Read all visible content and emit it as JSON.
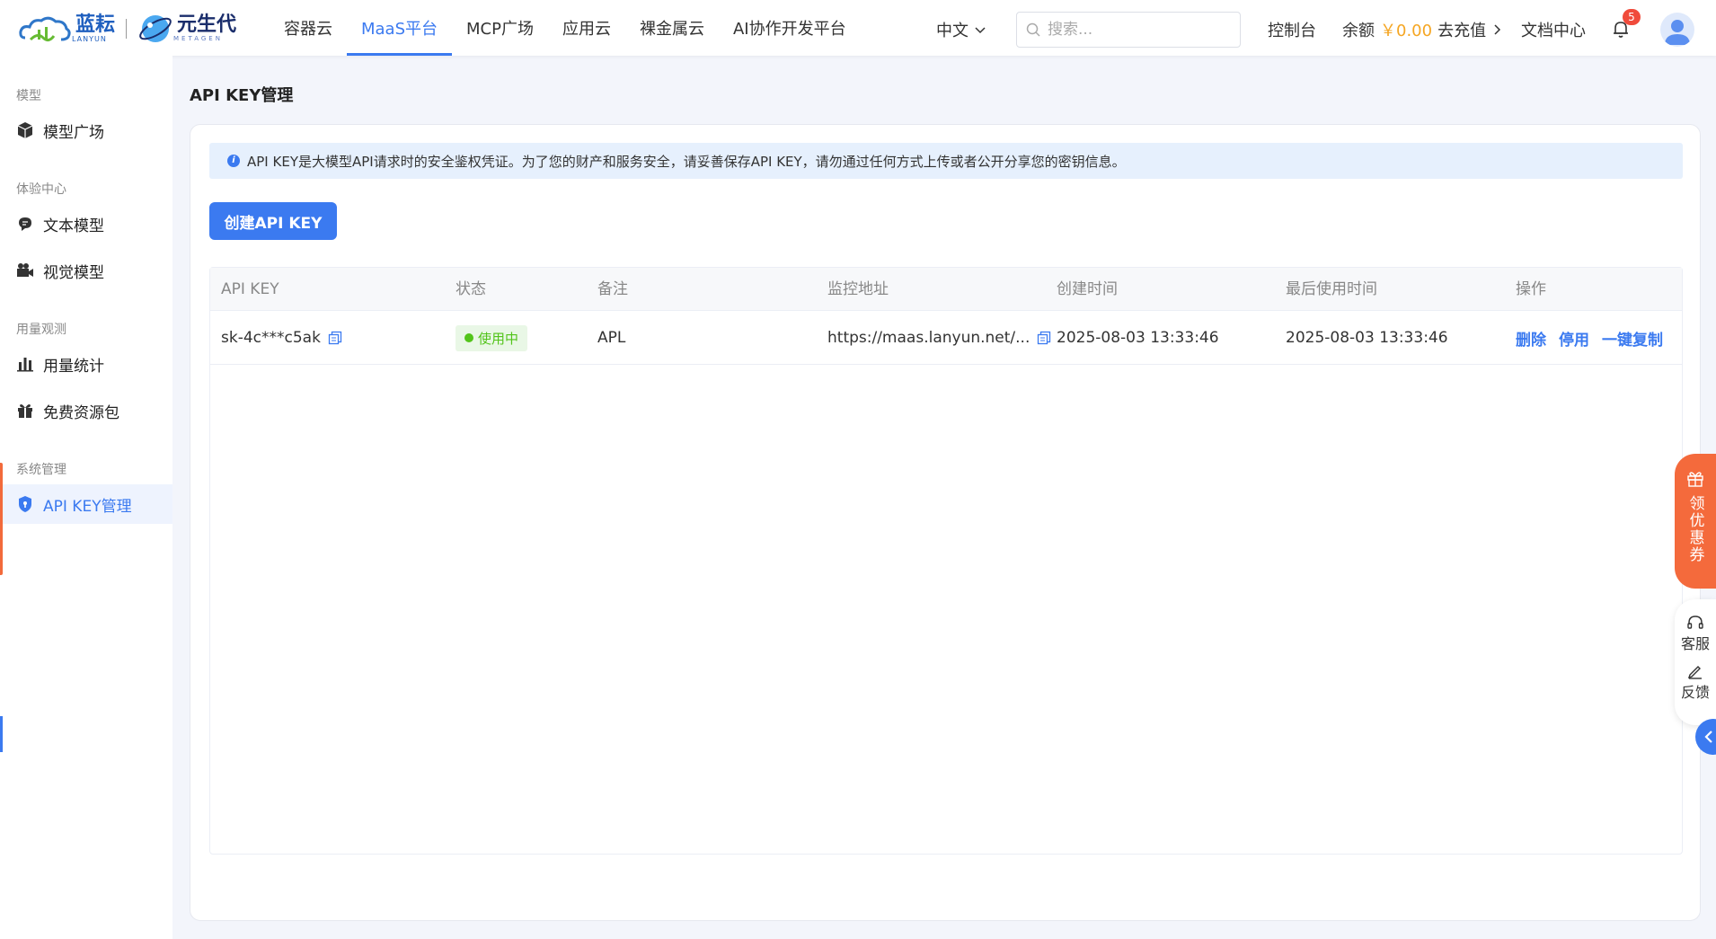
{
  "logo": {
    "brand1": "蓝耘",
    "brand1_sub": "LANYUN",
    "brand2": "元生代",
    "brand2_sub": "METAGEN"
  },
  "nav": {
    "items": [
      {
        "label": "容器云"
      },
      {
        "label": "MaaS平台",
        "active": true
      },
      {
        "label": "MCP广场"
      },
      {
        "label": "应用云"
      },
      {
        "label": "裸金属云"
      },
      {
        "label": "AI协作开发平台"
      }
    ],
    "language": "中文",
    "search_placeholder": "搜索...",
    "console": "控制台",
    "balance_label": "余额",
    "balance_amount": "￥0.00",
    "recharge": "去充值",
    "docs": "文档中心",
    "notification_count": "5"
  },
  "sidebar": {
    "groups": [
      {
        "title": "模型",
        "items": [
          {
            "label": "模型广场",
            "icon": "cube-icon"
          }
        ]
      },
      {
        "title": "体验中心",
        "items": [
          {
            "label": "文本模型",
            "icon": "chat-icon"
          },
          {
            "label": "视觉模型",
            "icon": "camera-icon"
          }
        ]
      },
      {
        "title": "用量观测",
        "items": [
          {
            "label": "用量统计",
            "icon": "bar-chart-icon"
          },
          {
            "label": "免费资源包",
            "icon": "gift-icon"
          }
        ]
      },
      {
        "title": "系统管理",
        "items": [
          {
            "label": "API KEY管理",
            "icon": "shield-icon",
            "active": true
          }
        ]
      }
    ]
  },
  "page": {
    "title": "API KEY管理",
    "notice": "API KEY是大模型API请求时的安全鉴权凭证。为了您的财产和服务安全，请妥善保存API KEY，请勿通过任何方式上传或者公开分享您的密钥信息。",
    "create_button": "创建API KEY"
  },
  "table": {
    "columns": [
      "API KEY",
      "状态",
      "备注",
      "监控地址",
      "创建时间",
      "最后使用时间",
      "操作"
    ],
    "rows": [
      {
        "api_key": "sk-4c***c5ak",
        "status": "使用中",
        "remark": "APL",
        "monitor_url": "https://maas.lanyun.net/...",
        "created_at": "2025-08-03 13:33:46",
        "last_used_at": "2025-08-03 13:33:46",
        "actions": [
          "删除",
          "停用",
          "一键复制"
        ]
      }
    ]
  },
  "floating": {
    "coupon": "领优惠券",
    "service": "客服",
    "feedback": "反馈"
  },
  "colors": {
    "primary": "#3b7af0",
    "success": "#52c41a",
    "coupon": "#f46a3c",
    "balance": "#f5a623"
  }
}
